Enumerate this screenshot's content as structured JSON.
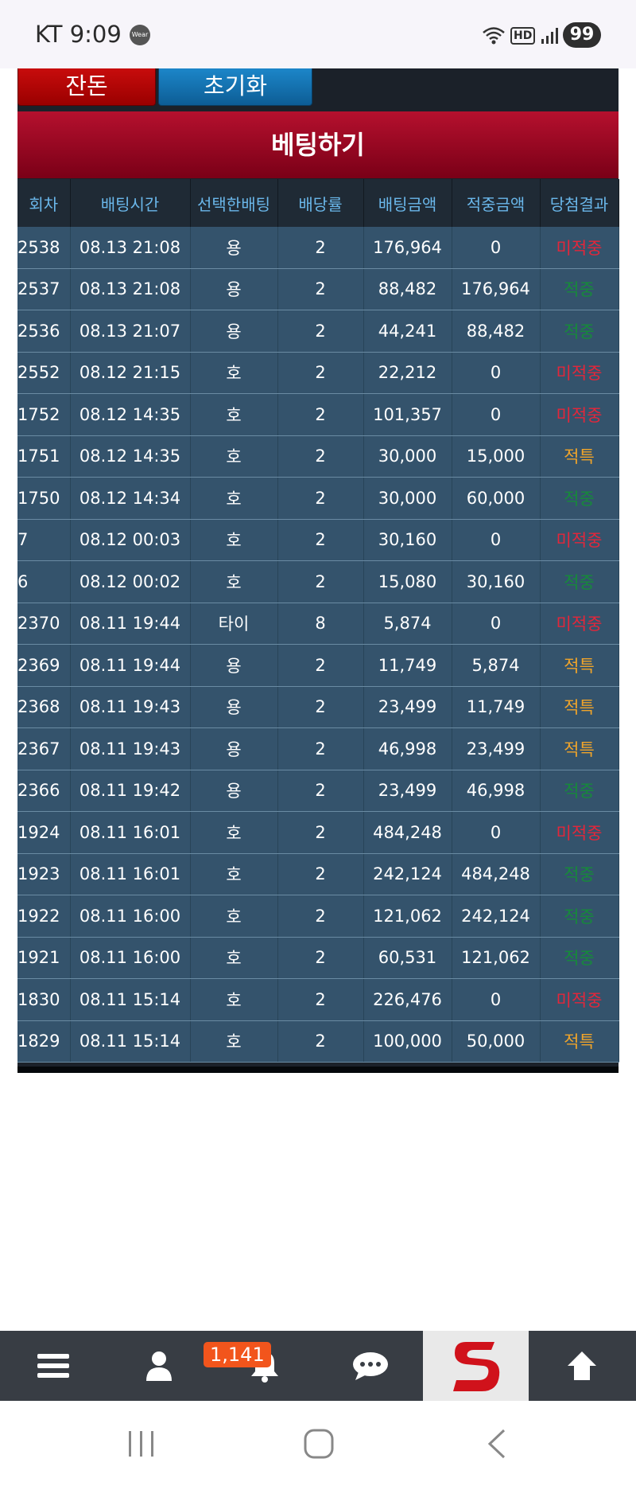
{
  "status_bar": {
    "carrier_time": "KT 9:09",
    "wear_label": "Wear",
    "hd_label": "HD",
    "battery": "99"
  },
  "top_buttons": {
    "balance": "잔돈",
    "reset": "초기화"
  },
  "betting": {
    "title": "베팅하기",
    "headers": [
      "회차",
      "배팅시간",
      "선택한배팅",
      "배당률",
      "배팅금액",
      "적중금액",
      "당첨결과"
    ],
    "rows": [
      {
        "round": "2538",
        "time": "08.13 21:08",
        "pick": "용",
        "odds": "2",
        "amount": "176,964",
        "payout": "0",
        "result": "미적중",
        "status": "loss"
      },
      {
        "round": "2537",
        "time": "08.13 21:08",
        "pick": "용",
        "odds": "2",
        "amount": "88,482",
        "payout": "176,964",
        "result": "적중",
        "status": "win"
      },
      {
        "round": "2536",
        "time": "08.13 21:07",
        "pick": "용",
        "odds": "2",
        "amount": "44,241",
        "payout": "88,482",
        "result": "적중",
        "status": "win"
      },
      {
        "round": "2552",
        "time": "08.12 21:15",
        "pick": "호",
        "odds": "2",
        "amount": "22,212",
        "payout": "0",
        "result": "미적중",
        "status": "loss"
      },
      {
        "round": "1752",
        "time": "08.12 14:35",
        "pick": "호",
        "odds": "2",
        "amount": "101,357",
        "payout": "0",
        "result": "미적중",
        "status": "loss"
      },
      {
        "round": "1751",
        "time": "08.12 14:35",
        "pick": "호",
        "odds": "2",
        "amount": "30,000",
        "payout": "15,000",
        "result": "적특",
        "status": "special"
      },
      {
        "round": "1750",
        "time": "08.12 14:34",
        "pick": "호",
        "odds": "2",
        "amount": "30,000",
        "payout": "60,000",
        "result": "적중",
        "status": "win"
      },
      {
        "round": "7",
        "time": "08.12 00:03",
        "pick": "호",
        "odds": "2",
        "amount": "30,160",
        "payout": "0",
        "result": "미적중",
        "status": "loss"
      },
      {
        "round": "6",
        "time": "08.12 00:02",
        "pick": "호",
        "odds": "2",
        "amount": "15,080",
        "payout": "30,160",
        "result": "적중",
        "status": "win"
      },
      {
        "round": "2370",
        "time": "08.11 19:44",
        "pick": "타이",
        "odds": "8",
        "amount": "5,874",
        "payout": "0",
        "result": "미적중",
        "status": "loss"
      },
      {
        "round": "2369",
        "time": "08.11 19:44",
        "pick": "용",
        "odds": "2",
        "amount": "11,749",
        "payout": "5,874",
        "result": "적특",
        "status": "special"
      },
      {
        "round": "2368",
        "time": "08.11 19:43",
        "pick": "용",
        "odds": "2",
        "amount": "23,499",
        "payout": "11,749",
        "result": "적특",
        "status": "special"
      },
      {
        "round": "2367",
        "time": "08.11 19:43",
        "pick": "용",
        "odds": "2",
        "amount": "46,998",
        "payout": "23,499",
        "result": "적특",
        "status": "special"
      },
      {
        "round": "2366",
        "time": "08.11 19:42",
        "pick": "용",
        "odds": "2",
        "amount": "23,499",
        "payout": "46,998",
        "result": "적중",
        "status": "win"
      },
      {
        "round": "1924",
        "time": "08.11 16:01",
        "pick": "호",
        "odds": "2",
        "amount": "484,248",
        "payout": "0",
        "result": "미적중",
        "status": "loss"
      },
      {
        "round": "1923",
        "time": "08.11 16:01",
        "pick": "호",
        "odds": "2",
        "amount": "242,124",
        "payout": "484,248",
        "result": "적중",
        "status": "win"
      },
      {
        "round": "1922",
        "time": "08.11 16:00",
        "pick": "호",
        "odds": "2",
        "amount": "121,062",
        "payout": "242,124",
        "result": "적중",
        "status": "win"
      },
      {
        "round": "1921",
        "time": "08.11 16:00",
        "pick": "호",
        "odds": "2",
        "amount": "60,531",
        "payout": "121,062",
        "result": "적중",
        "status": "win"
      },
      {
        "round": "1830",
        "time": "08.11 15:14",
        "pick": "호",
        "odds": "2",
        "amount": "226,476",
        "payout": "0",
        "result": "미적중",
        "status": "loss"
      },
      {
        "round": "1829",
        "time": "08.11 15:14",
        "pick": "호",
        "odds": "2",
        "amount": "100,000",
        "payout": "50,000",
        "result": "적특",
        "status": "special"
      }
    ]
  },
  "bottom_nav": {
    "notification_count": "1,141",
    "items": [
      "menu-icon",
      "user-icon",
      "bell-icon",
      "chat-icon",
      "site-logo",
      "arrow-up-icon"
    ]
  },
  "colors": {
    "loss": "#e4263a",
    "win": "#168a3a",
    "special": "#f0a42a",
    "header_text": "#6ab7ea",
    "row_bg": "#34536c",
    "badge": "#f2551c"
  }
}
